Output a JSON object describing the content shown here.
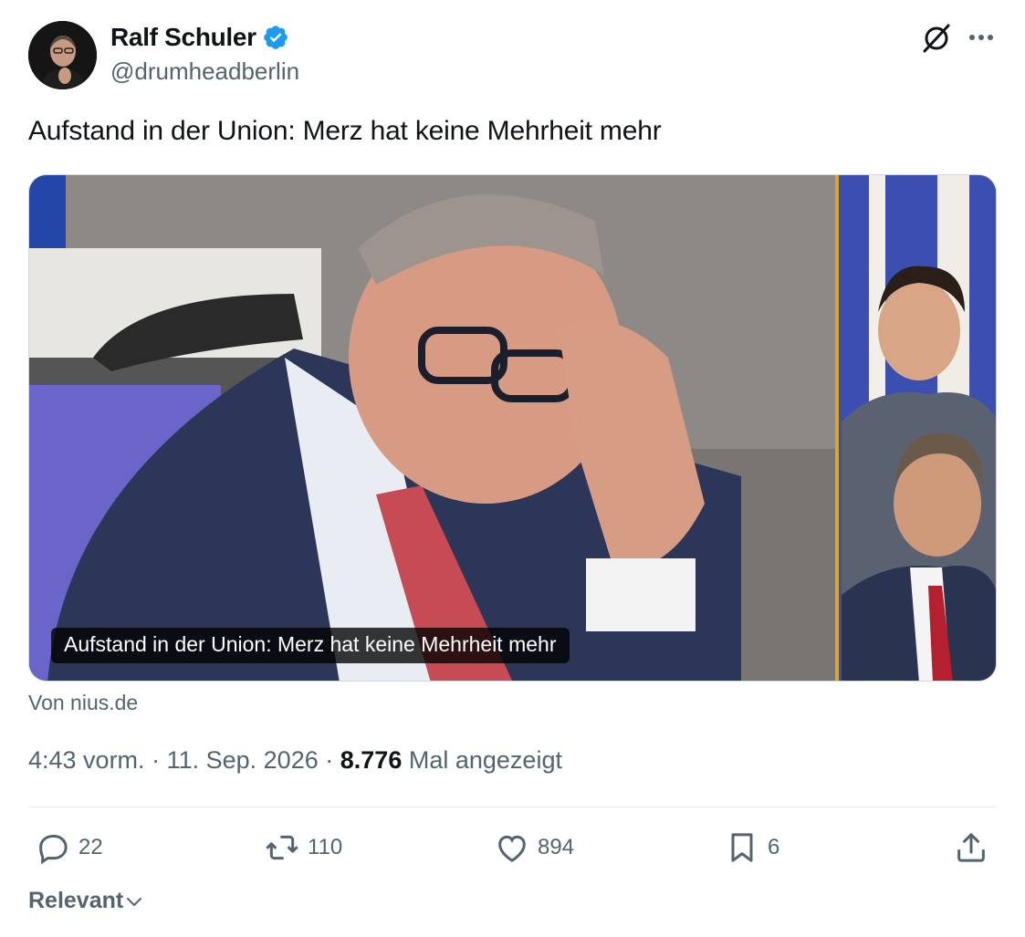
{
  "author": {
    "display_name": "Ralf Schuler",
    "handle": "@drumheadberlin",
    "verified": true
  },
  "tweet": {
    "text": "Aufstand in der Union: Merz hat keine Mehrheit mehr"
  },
  "media": {
    "caption": "Aufstand in der Union: Merz hat keine Mehrheit mehr",
    "source": "Von nius.de"
  },
  "meta": {
    "time": "4:43 vorm.",
    "date": "11. Sep. 2026",
    "separator": "·",
    "views": "8.776",
    "views_label": "Mal angezeigt"
  },
  "actions": {
    "replies": "22",
    "retweets": "110",
    "likes": "894",
    "bookmarks": "6"
  },
  "sort": {
    "label": "Relevant"
  },
  "icons": [
    "verified-badge-icon",
    "grok-icon",
    "more-icon",
    "reply-icon",
    "retweet-icon",
    "like-icon",
    "bookmark-icon",
    "share-icon",
    "chevron-down-icon"
  ],
  "colors": {
    "accent": "#1d9bf0",
    "text": "#0f1419",
    "secondary": "#536471"
  }
}
